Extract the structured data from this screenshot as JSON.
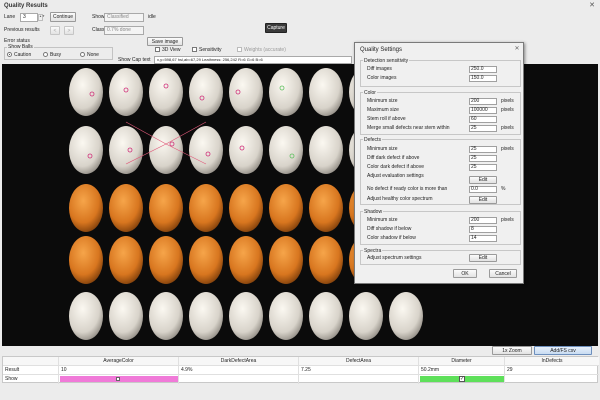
{
  "window": {
    "title": "Quality Results"
  },
  "top": {
    "lane_label": "Lane",
    "lane_value": "3",
    "continue_label": "Continue",
    "show_label": "Show",
    "show_value": "Classified",
    "idle_label": "idle",
    "previous_results_label": "Previous results",
    "class_label": "Class",
    "class_value": "0.7% done",
    "capture_label": "Capture",
    "error_status_label": "Error status",
    "save_image_label": "Save image",
    "show_balls_group": "Show Balls",
    "radio_options": [
      "Caution",
      "Busy",
      "None"
    ],
    "radio_selected": "Caution",
    "checkbox_3d_view": "3D View",
    "checkbox_sensitivity": "Sensitivity",
    "checkbox_weights": "Weights (accurate)",
    "show_cap_text_label": "Show Cap text",
    "cap_text_value": "x,y=598,67 hsl,ab=67,29 Leathness: 256,242 R=6 G=6 B=6"
  },
  "viewer": {
    "egg_colors": [
      "white",
      "white",
      "white",
      "white",
      "white",
      "white",
      "white",
      "white",
      "white",
      "white",
      "white",
      "white",
      "white",
      "white",
      "white",
      "white",
      "white",
      "white",
      "orange",
      "orange",
      "orange",
      "orange",
      "orange",
      "orange",
      "orange",
      "orange",
      "orange",
      "orange",
      "orange",
      "orange",
      "orange",
      "orange",
      "orange",
      "orange",
      "orange",
      "orange",
      "white",
      "white",
      "white",
      "white",
      "white",
      "white",
      "white",
      "white",
      "white"
    ]
  },
  "dialog": {
    "title": "Quality Settings",
    "close_icon": "close-icon",
    "groups": {
      "detection": {
        "title": "Detection sensitivity",
        "rows": [
          {
            "label": "Diff images",
            "value": "250.0",
            "unit": ""
          },
          {
            "label": "Color images",
            "value": "150.0",
            "unit": ""
          }
        ]
      },
      "color": {
        "title": "Color",
        "rows": [
          {
            "label": "Minimum size",
            "value": "200",
            "unit": "pixels"
          },
          {
            "label": "Maximum size",
            "value": "100000",
            "unit": "pixels"
          },
          {
            "label": "Stem roll if above",
            "value": "60",
            "unit": ""
          },
          {
            "label": "Merge small defects near stem within",
            "value": "25",
            "unit": "pixels"
          }
        ]
      },
      "defects": {
        "title": "Defects",
        "rows": [
          {
            "label": "Minimum size",
            "value": "25",
            "unit": "pixels"
          },
          {
            "label": "Diff dark defect if above",
            "value": "25",
            "unit": ""
          },
          {
            "label": "Color dark defect if above",
            "value": "25",
            "unit": ""
          }
        ],
        "adjust_eval_label": "Adjust evaluation settings",
        "edit_label": "Edit",
        "no_defect_label": "No defect if ready color is more than",
        "no_defect_value": "0.0",
        "no_defect_unit": "%",
        "adjust_healthy_label": "Adjust healthy color spectrum"
      },
      "shadow": {
        "title": "Shadow",
        "rows": [
          {
            "label": "Minimum size",
            "value": "200",
            "unit": "pixels"
          },
          {
            "label": "Diff shadow if below",
            "value": "8",
            "unit": ""
          },
          {
            "label": "Color shadow if below",
            "value": "14",
            "unit": ""
          }
        ]
      },
      "spectra": {
        "title": "Spectra",
        "adjust_label": "Adjust spectrum settings",
        "edit_label": "Edit"
      }
    },
    "ok_label": "OK",
    "cancel_label": "Cancel"
  },
  "bottom_buttons": {
    "zoom_label": "1x Zoom",
    "adjust_label": "Add/FS csv"
  },
  "table": {
    "columns": [
      "",
      "AverageColor",
      "DarkDefectArea",
      "DefectArea",
      "Diameter",
      "InDefects"
    ],
    "rows": [
      {
        "label": "Result",
        "values": [
          "10",
          "4.9%",
          "7.25",
          "50.2mm",
          "29"
        ]
      },
      {
        "label": "Show",
        "values": [
          "",
          "",
          "",
          "",
          ""
        ]
      }
    ],
    "swatch_pink": "#f07ad8",
    "swatch_green": "#5ee05a"
  }
}
